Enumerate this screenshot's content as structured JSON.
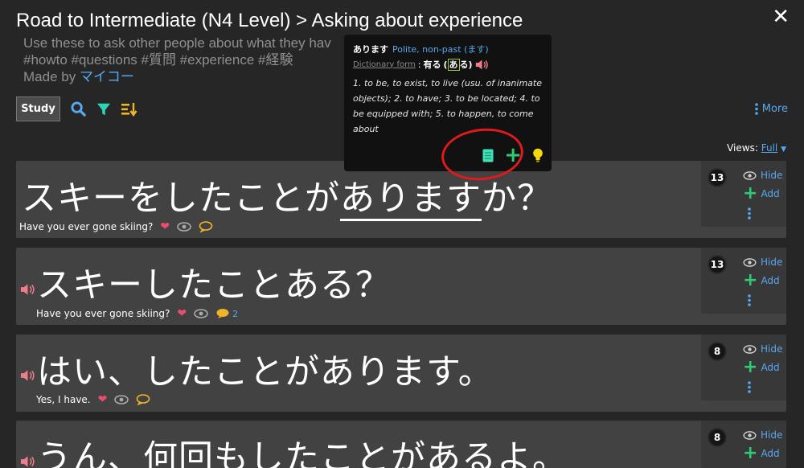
{
  "header": {
    "title": "Road to Intermediate (N4 Level) > Asking about experience",
    "description": "Use these to ask other people about what they hav",
    "tags": "#howto #questions #質問 #experience #経験",
    "made_by_label": "Made by ",
    "author": "マイコー"
  },
  "toolbar": {
    "study_label": "Study",
    "more_label": "More"
  },
  "views": {
    "label": "Views:",
    "value": "Full"
  },
  "popup": {
    "word": "あります",
    "form": "Polite, non-past (ます)",
    "dict_label": "Dictionary form",
    "dict_kanji": "有る",
    "dict_kana_hl": "あ",
    "dict_kana_rest": "る",
    "definitions": "1. to be, to exist, to live (usu. of inanimate objects); 2. to have; 3. to be located; 4. to be equipped with; 5. to happen, to come about"
  },
  "cards": [
    {
      "jp_pre": "スキーをしたことが",
      "jp_ul": "あります",
      "jp_post": "か？",
      "en": "Have you ever gone skiing?",
      "count": "13",
      "comments": "",
      "hide": "Hide",
      "add": "Add"
    },
    {
      "jp": "スキーしたことある？",
      "en": "Have you ever gone skiing?",
      "count": "13",
      "comments": "2",
      "hide": "Hide",
      "add": "Add"
    },
    {
      "jp": "はい、したことがあります。",
      "en": "Yes, I have.",
      "count": "8",
      "comments": "",
      "hide": "Hide",
      "add": "Add"
    },
    {
      "jp": "うん、何回もしたことがあるよ。",
      "en": "",
      "count": "8",
      "comments": "",
      "hide": "Hide",
      "add": "Add"
    }
  ],
  "colors": {
    "accent": "#58a8ef",
    "heart": "#e94e6d",
    "speaker": "#f07c8c",
    "green": "#2ecc71",
    "comment": "#f0b429",
    "bulb": "#f5d90a"
  }
}
